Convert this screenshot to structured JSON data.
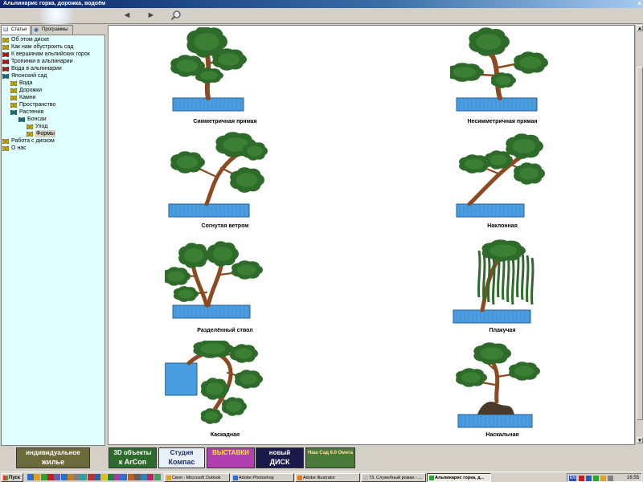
{
  "window": {
    "title": "Альпинарис горка, дорожка, водоём",
    "close_glyph": "×"
  },
  "toolbar": {
    "back": "◄",
    "forward": "►",
    "search": "⚲"
  },
  "left_tabs": [
    {
      "label": "Статьи",
      "icon": "book-icon"
    },
    {
      "label": "Программы",
      "icon": "globe-icon"
    }
  ],
  "tree": [
    {
      "label": "Об этом диске",
      "level": 0,
      "icon": "question-book-icon",
      "color": "#c8a800"
    },
    {
      "label": "Как нам обустроить сад",
      "level": 0,
      "icon": "question-book-icon",
      "color": "#c8a800"
    },
    {
      "label": "К вершинам альпийских горок",
      "level": 0,
      "icon": "book-icon",
      "color": "#b01818"
    },
    {
      "label": "Тропинки в альпинарии",
      "level": 0,
      "icon": "book-icon",
      "color": "#b01818"
    },
    {
      "label": "Вода в альпинарии",
      "level": 0,
      "icon": "book-icon",
      "color": "#b01818"
    },
    {
      "label": "Японский сад",
      "level": 0,
      "icon": "open-book-icon",
      "color": "#18707a"
    },
    {
      "label": "Вода",
      "level": 1,
      "icon": "question-book-icon",
      "color": "#c8a800"
    },
    {
      "label": "Дорожки",
      "level": 1,
      "icon": "question-book-icon",
      "color": "#c8a800"
    },
    {
      "label": "Камни",
      "level": 1,
      "icon": "question-book-icon",
      "color": "#c8a800"
    },
    {
      "label": "Пространство",
      "level": 1,
      "icon": "question-book-icon",
      "color": "#c8a800"
    },
    {
      "label": "Растения",
      "level": 1,
      "icon": "open-book-icon",
      "color": "#18707a"
    },
    {
      "label": "Бонсаи",
      "level": 2,
      "icon": "open-book-icon",
      "color": "#18707a"
    },
    {
      "label": "Уход",
      "level": 3,
      "icon": "question-book-icon",
      "color": "#c8a800"
    },
    {
      "label": "Формы",
      "level": 3,
      "icon": "question-book-icon",
      "color": "#c8a800",
      "selected": true
    },
    {
      "label": "Работа с диском",
      "level": 0,
      "icon": "question-book-icon",
      "color": "#c8a800"
    },
    {
      "label": "О нас",
      "level": 0,
      "icon": "question-book-icon",
      "color": "#c8a800"
    }
  ],
  "forms": [
    {
      "caption": "Симметричная прямая",
      "style": "symmetric"
    },
    {
      "caption": "Несимметричная прямая",
      "style": "asymmetric"
    },
    {
      "caption": "Согнутая ветром",
      "style": "windswept"
    },
    {
      "caption": "Наклонная",
      "style": "slanting"
    },
    {
      "caption": "Разделённый ствол",
      "style": "split"
    },
    {
      "caption": "Плакучая",
      "style": "weeping"
    },
    {
      "caption": "Каскадная",
      "style": "cascade"
    },
    {
      "caption": "Наскальная",
      "style": "rock"
    }
  ],
  "colors": {
    "pot": "#4a9ee0",
    "pot_edge": "#1f5f9a",
    "trunk": "#8b4a22",
    "foliage": "#2e6b2a",
    "tree_bg": "#e0ffff"
  },
  "banners": [
    {
      "line1": "индивидуальное",
      "line2": "жилье",
      "bg": "#6a6a3a",
      "fg": "#ffffff"
    },
    {
      "line1": "3D объекты",
      "line2": "к ArCon",
      "bg": "#2d6b2d",
      "fg": "#ffffff"
    },
    {
      "line1": "Студия",
      "line2": "Компас",
      "bg": "#e8f0f8",
      "fg": "#1a2a6a"
    },
    {
      "line1": "ВЫСТАВКИ",
      "line2": "",
      "bg": "#b040b0",
      "fg": "#ffe040"
    },
    {
      "line1": "новый",
      "line2": "ДИСК",
      "bg": "#1a1a4a",
      "fg": "#ffffff"
    },
    {
      "line1": "",
      "line2": "Наш Сад 6.0 Омега",
      "bg": "#4a7a3a",
      "fg": "#ffe0a0"
    }
  ],
  "taskbar": {
    "start": "Пуск",
    "tasks": [
      {
        "label": "Своя - Microsoft Outlook",
        "active": false
      },
      {
        "label": "Adobe Photoshop",
        "active": false
      },
      {
        "label": "Adobe Illustrator",
        "active": false
      },
      {
        "label": "73. Служебный роман - ...",
        "active": false
      },
      {
        "label": "Альпинарис горка, д...",
        "active": true
      }
    ],
    "lang": "EN",
    "clock": "16:55"
  }
}
